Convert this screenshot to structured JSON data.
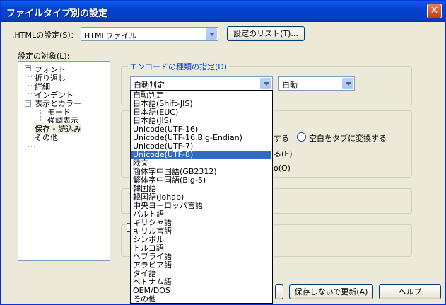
{
  "window": {
    "title": "ファイルタイプ別の設定",
    "close_glyph": "✕"
  },
  "settings_row": {
    "label": ".HTMLの設定(S)：",
    "filetype_value": "HTMLファイル",
    "list_button": "設定のリスト(T)..."
  },
  "target": {
    "label": "設定の対象(L):",
    "tree": [
      {
        "label": "フォント",
        "expander": "+"
      },
      {
        "label": "折り返し"
      },
      {
        "label": "詳細"
      },
      {
        "label": "インデント"
      },
      {
        "label": "表示とカラー",
        "expander": "−"
      },
      {
        "label": "モード"
      },
      {
        "label": "強調表示"
      },
      {
        "label": "保存・読込み",
        "selected": true
      },
      {
        "label": "その他"
      }
    ]
  },
  "encoding": {
    "group_title": "エンコードの種類の指定(D)",
    "selected": "自動判定",
    "linebreak_value": "自動",
    "dropdown_items": [
      "自動判定",
      "日本語(Shift-JIS)",
      "日本語(EUC)",
      "日本語(JIS)",
      "Unicode(UTF-16)",
      "Unicode(UTF-16,Big-Endian)",
      "Unicode(UTF-7)",
      "Unicode(UTF-8)",
      "欧文",
      "簡体字中国語(GB2312)",
      "繁体字中国語(Big-5)",
      "韓国語",
      "韓国語(Johab)",
      "中央ヨーロッパ言語",
      "バルト語",
      "ギリシャ語",
      "キリル言語",
      "シンボル",
      "トルコ語",
      "ヘブライ語",
      "アラビア語",
      "タイ語",
      "ベトナム語",
      "OEM/DOS",
      "その他"
    ],
    "highlighted_index": 7
  },
  "partial_texts": {
    "convert_suffix": "する",
    "space_to_tab": "空白をタブに変換する",
    "option_e": "る(E)",
    "option_o": "o(O)"
  },
  "buttons": {
    "update_without_save": "保存しないで更新(A)",
    "help": "ヘルプ"
  },
  "colors": {
    "title_blue": "#0a5fe6",
    "group_title": "#0046d5",
    "highlight": "#316ac5"
  }
}
